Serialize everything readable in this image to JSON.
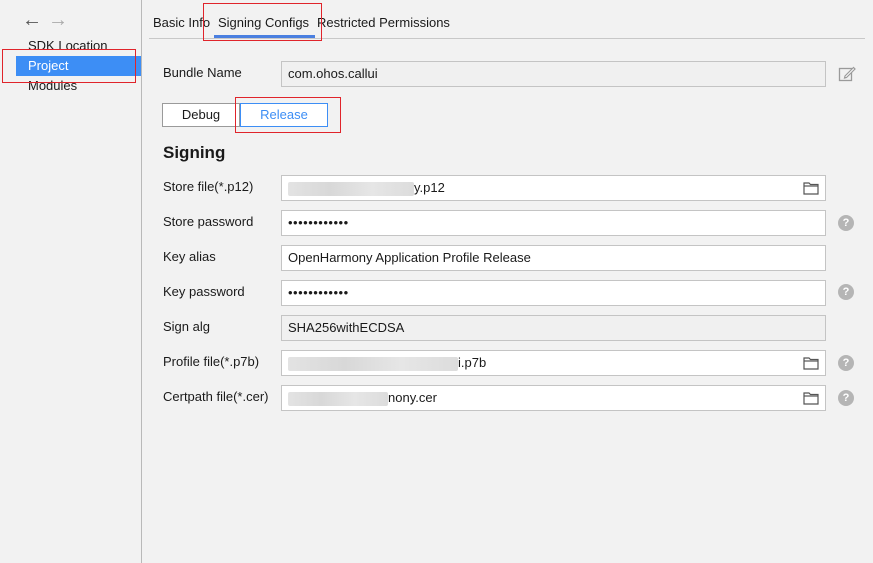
{
  "nav": {
    "back_glyph": "←",
    "forward_glyph": "→"
  },
  "sidebar": {
    "items": [
      {
        "label": "SDK Location"
      },
      {
        "label": "Project",
        "selected": true
      },
      {
        "label": "Modules"
      }
    ]
  },
  "tabs": [
    {
      "label": "Basic Info"
    },
    {
      "label": "Signing Configs",
      "active": true
    },
    {
      "label": "Restricted Permissions"
    }
  ],
  "bundle": {
    "label": "Bundle Name",
    "value": "com.ohos.callui"
  },
  "modes": {
    "debug": "Debug",
    "release": "Release",
    "selected": "Release"
  },
  "signing": {
    "heading": "Signing",
    "store_file": {
      "label": "Store file(*.p12)",
      "value_suffix": "y.p12"
    },
    "store_password": {
      "label": "Store password",
      "value": "••••••••••••"
    },
    "key_alias": {
      "label": "Key alias",
      "value": "OpenHarmony Application Profile Release"
    },
    "key_password": {
      "label": "Key password",
      "value": "••••••••••••"
    },
    "sign_alg": {
      "label": "Sign alg",
      "value": "SHA256withECDSA"
    },
    "profile_file": {
      "label": "Profile file(*.p7b)",
      "value_suffix": "i.p7b"
    },
    "certpath_file": {
      "label": "Certpath file(*.cer)",
      "value_suffix": "nony.cer"
    }
  },
  "colors": {
    "accent": "#3d8ef5",
    "highlight_box": "#e0242b",
    "tab_underline": "#4a7fe0"
  },
  "icons": [
    "back-arrow-icon",
    "forward-arrow-icon",
    "edit-icon",
    "folder-icon",
    "help-icon"
  ]
}
